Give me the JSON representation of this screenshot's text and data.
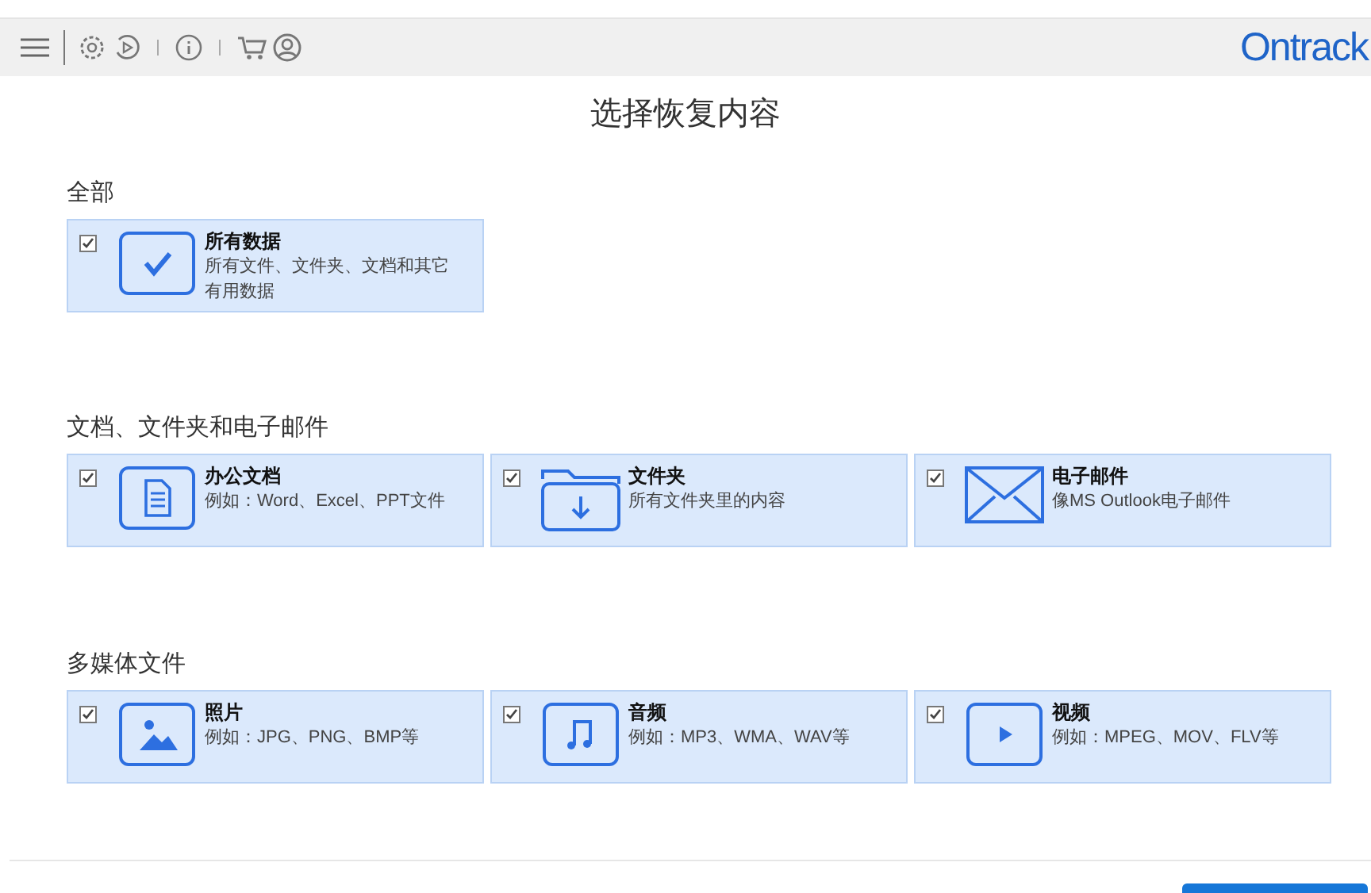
{
  "toolbar": {
    "brand": "Ontrack"
  },
  "heading": "选择恢复内容",
  "sections": [
    {
      "label": "全部",
      "cards": [
        {
          "title": "所有数据",
          "description": "所有文件、文件夹、文档和其它有用数据",
          "checked": true
        }
      ]
    },
    {
      "label": "文档、文件夹和电子邮件",
      "cards": [
        {
          "title": "办公文档",
          "description": "例如：Word、Excel、PPT文件",
          "checked": true
        },
        {
          "title": "文件夹",
          "description": "所有文件夹里的内容",
          "checked": true
        },
        {
          "title": "电子邮件",
          "description": "像MS Outlook电子邮件",
          "checked": true
        }
      ]
    },
    {
      "label": "多媒体文件",
      "cards": [
        {
          "title": "照片",
          "description": "例如：JPG、PNG、BMP等",
          "checked": true
        },
        {
          "title": "音频",
          "description": "例如：MP3、WMA、WAV等",
          "checked": true
        },
        {
          "title": "视频",
          "description": "例如：MPEG、MOV、FLV等",
          "checked": true
        }
      ]
    }
  ]
}
